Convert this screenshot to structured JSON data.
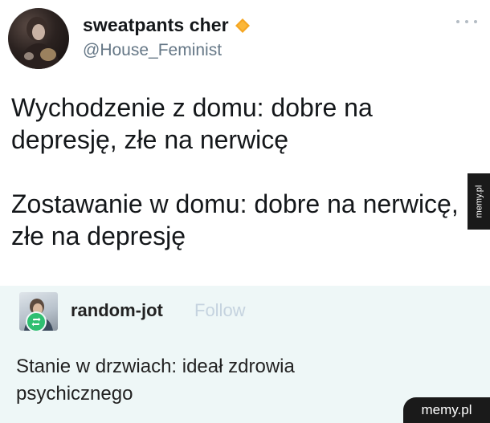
{
  "tweet": {
    "display_name": "sweatpants cher",
    "handle": "@House_Feminist",
    "verified_icon": "verified-diamond-icon",
    "verified_color": "#f5a623",
    "more_icon": "more-dots-icon",
    "text_lines": [
      "Wychodzenie z domu: dobre na depresję, złe na nerwicę",
      "Zostawanie w domu: dobre na nerwicę, złe na depresję"
    ]
  },
  "reply": {
    "username": "random-jot",
    "follow_label": "Follow",
    "badge_icon": "reblog-icon",
    "badge_color": "#2fbf71",
    "text": "Stanie w drzwiach: ideał zdrowia psychicznego"
  },
  "watermarks": {
    "side": "memy.pl",
    "corner": "memy.pl"
  }
}
